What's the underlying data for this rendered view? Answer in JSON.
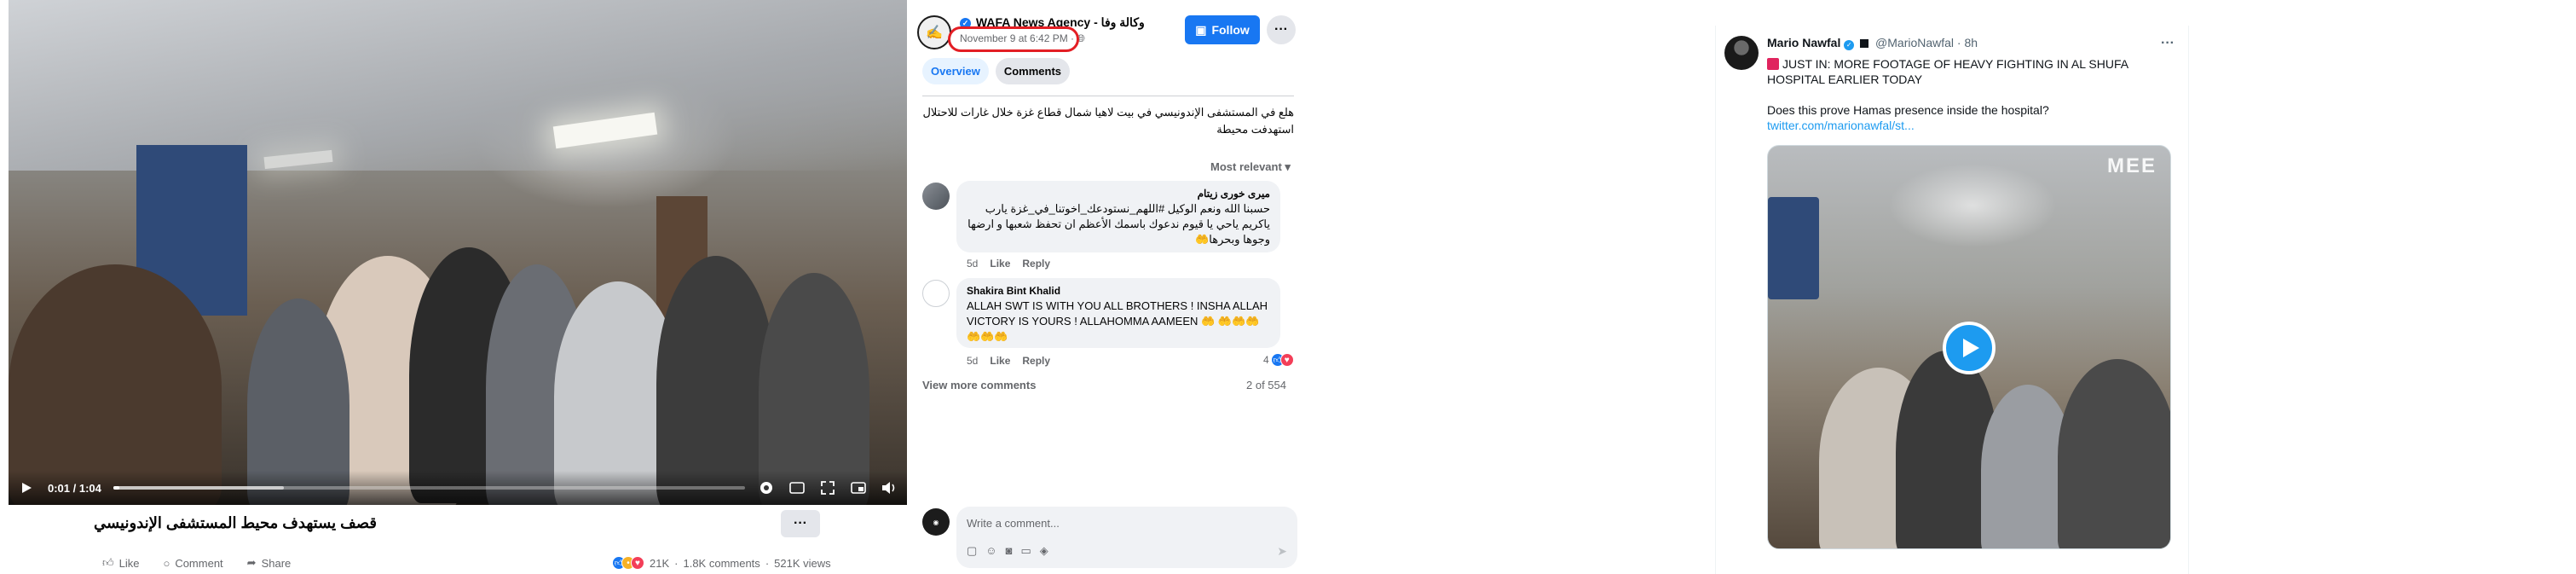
{
  "facebook": {
    "video": {
      "time": "0:01 / 1:04",
      "progress": 0.01,
      "buffered": 0.27
    },
    "post": {
      "title": "قصف يستهدف محيط المستشفى الإندونيسي",
      "more_label": "···",
      "actions": {
        "like": "Like",
        "comment": "Comment",
        "share": "Share"
      },
      "stats": {
        "reactions": "21K",
        "comments": "1.8K comments",
        "views": "521K views"
      }
    },
    "side": {
      "page_name": "WAFA News Agency - وكالة وفا",
      "post_date": "November 9 at 6:42 PM · ",
      "follow_label": "Follow",
      "more_label": "···",
      "tabs": [
        "Overview",
        "Comments"
      ],
      "post_text": "هلع في المستشفى الإندونيسي في بيت لاهيا شمال قطاع غزة خلال غارات للاحتلال استهدفت محيطة",
      "sort_label": "Most relevant ▾",
      "comments": [
        {
          "author": "ميرى خورى زيتام",
          "text": "حسبنا الله ونعم الوكيل #اللهم_نستودعك_اخوتنا_في_غزة يارب ياكريم ياحي يا قيوم ندعوك باسمك الأعظم ان تحفظ شعبها و ارضها وجوها وبحرها🤲",
          "time": "5d",
          "like": "Like",
          "reply": "Reply"
        },
        {
          "author": "Shakira Bint Khalid",
          "text": "ALLAH SWT IS WITH YOU ALL BROTHERS ! INSHA ALLAH VICTORY IS YOURS ! ALLAHOMMA AAMEEN 🤲 🤲🤲🤲🤲🤲🤲",
          "time": "5d",
          "like": "Like",
          "reply": "Reply",
          "reaction_count": "4"
        }
      ],
      "view_more": "View more comments",
      "comment_count": "2 of 554",
      "composer_placeholder": "Write a comment..."
    }
  },
  "twitter": {
    "name": "Mario Nawfal",
    "handle": "@MarioNawfal · 8h",
    "more_label": "···",
    "text_line1": "JUST IN: MORE FOOTAGE OF HEAVY FIGHTING IN AL SHUFA HOSPITAL EARLIER TODAY",
    "text_line2": "Does this prove Hamas presence inside the hospital?",
    "link": "twitter.com/marionawfal/st...",
    "watermark": "MEE"
  },
  "colors": {
    "fb_blue": "#1877f2",
    "tw_blue": "#1d9bf0",
    "highlight_red": "#e31e24"
  }
}
